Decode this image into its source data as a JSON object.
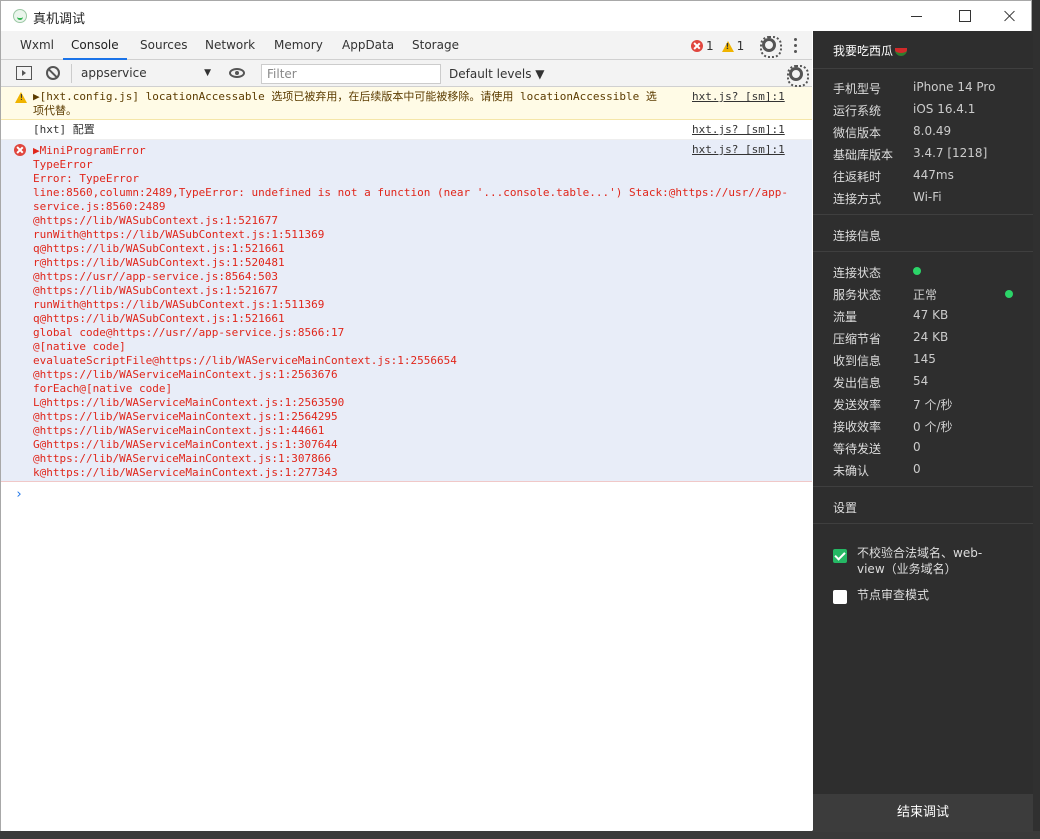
{
  "window": {
    "title": "真机调试"
  },
  "tabs": [
    {
      "label": "Wxml"
    },
    {
      "label": "Console"
    },
    {
      "label": "Sources"
    },
    {
      "label": "Network"
    },
    {
      "label": "Memory"
    },
    {
      "label": "AppData"
    },
    {
      "label": "Storage"
    }
  ],
  "counts": {
    "errors": "1",
    "warnings": "1"
  },
  "toolbar": {
    "context": "appservice",
    "filter_placeholder": "Filter",
    "levels": "Default levels ▼"
  },
  "console": {
    "warn": {
      "text": "▶[hxt.config.js] locationAccessable 选项已被弃用，在后续版本中可能被移除。请使用 locationAccessible 选\n项代替。",
      "source": "hxt.js? [sm]:1"
    },
    "log": {
      "text": "[hxt] 配置",
      "source": "hxt.js? [sm]:1"
    },
    "error": {
      "source": "hxt.js? [sm]:1",
      "lines": [
        "▶MiniProgramError",
        "TypeError",
        "Error: TypeError",
        "line:8560,column:2489,TypeError: undefined is not a function (near '...console.table...') Stack:@https://usr//app-",
        "service.js:8560:2489",
        "@https://lib/WASubContext.js:1:521677",
        "runWith@https://lib/WASubContext.js:1:511369",
        "q@https://lib/WASubContext.js:1:521661",
        "r@https://lib/WASubContext.js:1:520481",
        "@https://usr//app-service.js:8564:503",
        "@https://lib/WASubContext.js:1:521677",
        "runWith@https://lib/WASubContext.js:1:511369",
        "q@https://lib/WASubContext.js:1:521661",
        "global code@https://usr//app-service.js:8566:17",
        "@[native code]",
        "evaluateScriptFile@https://lib/WAServiceMainContext.js:1:2556654",
        "@https://lib/WAServiceMainContext.js:1:2563676",
        "forEach@[native code]",
        "L@https://lib/WAServiceMainContext.js:1:2563590",
        "@https://lib/WAServiceMainContext.js:1:2564295",
        "@https://lib/WAServiceMainContext.js:1:44661",
        "G@https://lib/WAServiceMainContext.js:1:307644",
        "@https://lib/WAServiceMainContext.js:1:307866",
        "k@https://lib/WAServiceMainContext.js:1:277343"
      ]
    },
    "prompt": "›"
  },
  "panel": {
    "title": "我要吃西瓜",
    "device": [
      {
        "k": "手机型号",
        "v": "iPhone 14 Pro"
      },
      {
        "k": "运行系统",
        "v": "iOS 16.4.1"
      },
      {
        "k": "微信版本",
        "v": "8.0.49"
      },
      {
        "k": "基础库版本",
        "v": "3.4.7 [1218]"
      },
      {
        "k": "往返耗时",
        "v": "447ms"
      },
      {
        "k": "连接方式",
        "v": "Wi-Fi"
      }
    ],
    "conn_title": "连接信息",
    "conn": [
      {
        "k": "连接状态",
        "v": ""
      },
      {
        "k": "服务状态",
        "v": "正常"
      },
      {
        "k": "流量",
        "v": "47 KB"
      },
      {
        "k": "压缩节省",
        "v": "24 KB"
      },
      {
        "k": "收到信息",
        "v": "145"
      },
      {
        "k": "发出信息",
        "v": "54"
      },
      {
        "k": "发送效率",
        "v": "7 个/秒"
      },
      {
        "k": "接收效率",
        "v": "0 个/秒"
      },
      {
        "k": "等待发送",
        "v": "0"
      },
      {
        "k": "未确认",
        "v": "0"
      }
    ],
    "settings_title": "设置",
    "opt1": "不校验合法域名、web-view（业务域名）",
    "opt2": "节点审查模式",
    "end_button": "结束调试",
    "status_color": "#2bd468"
  }
}
